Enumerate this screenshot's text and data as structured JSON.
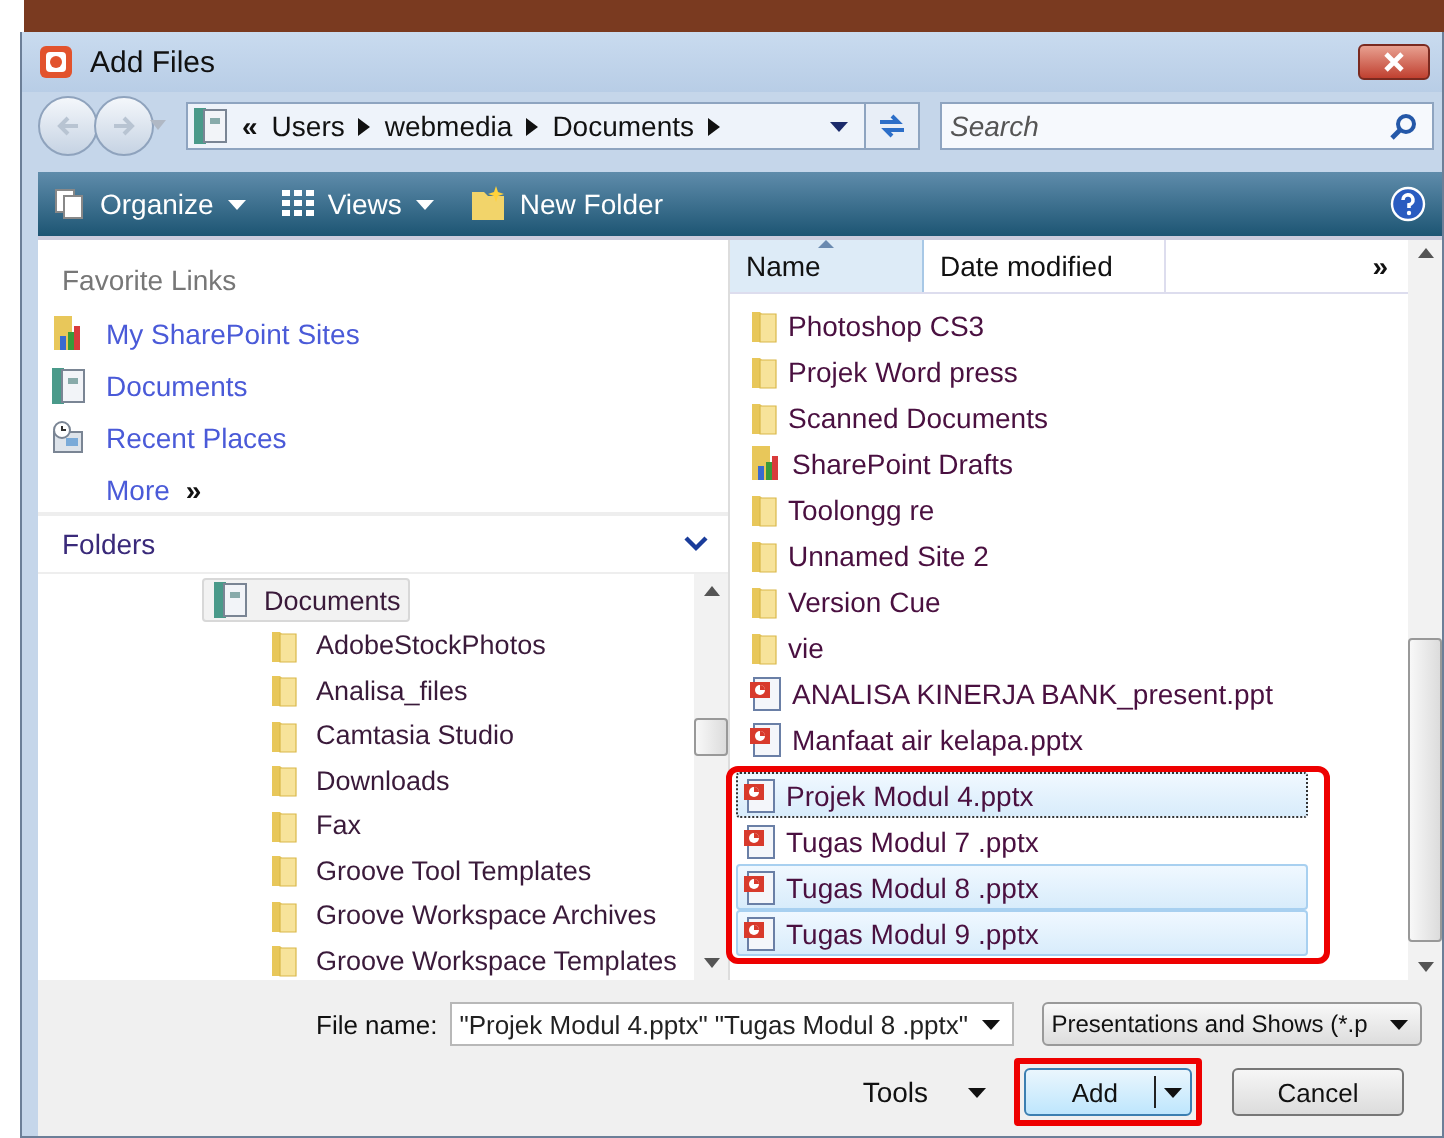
{
  "window": {
    "title": "Add Files"
  },
  "address": {
    "crumbs": [
      "Users",
      "webmedia",
      "Documents"
    ],
    "overflow": "«"
  },
  "search": {
    "placeholder": "Search"
  },
  "toolbar": [
    {
      "kind": "organize",
      "label": "Organize",
      "dropdown": true
    },
    {
      "kind": "views",
      "label": "Views",
      "dropdown": true
    },
    {
      "kind": "newfolder",
      "label": "New Folder",
      "dropdown": false
    }
  ],
  "favorites": {
    "title": "Favorite Links",
    "items": [
      {
        "kind": "sharepoint",
        "label": "My SharePoint Sites"
      },
      {
        "kind": "documents",
        "label": "Documents"
      },
      {
        "kind": "recent",
        "label": "Recent Places"
      }
    ],
    "more": "More",
    "more_icon": "»"
  },
  "folders": {
    "title": "Folders",
    "expanded": true,
    "tree": [
      {
        "label": "Documents",
        "kind": "documents",
        "selected": true,
        "children": [
          {
            "label": "AdobeStockPhotos",
            "kind": "folder",
            "selected": false
          },
          {
            "label": "Analisa_files",
            "kind": "folder",
            "selected": false
          },
          {
            "label": "Camtasia Studio",
            "kind": "folder",
            "selected": false
          },
          {
            "label": "Downloads",
            "kind": "folder",
            "selected": false
          },
          {
            "label": "Fax",
            "kind": "folder",
            "selected": false
          },
          {
            "label": "Groove Tool Templates",
            "kind": "folder",
            "selected": false
          },
          {
            "label": "Groove Workspace Archives",
            "kind": "folder",
            "selected": false
          },
          {
            "label": "Groove Workspace Templates",
            "kind": "folder",
            "selected": false
          }
        ]
      }
    ]
  },
  "columns": [
    "Name",
    "Date modified"
  ],
  "column_overflow": "»",
  "files": [
    {
      "name": "Photoshop CS3",
      "kind": "folder",
      "selected": false,
      "focused": false
    },
    {
      "name": "Projek Word press",
      "kind": "folder",
      "selected": false,
      "focused": false
    },
    {
      "name": "Scanned Documents",
      "kind": "folder",
      "selected": false,
      "focused": false
    },
    {
      "name": "SharePoint Drafts",
      "kind": "sharepoint",
      "selected": false,
      "focused": false
    },
    {
      "name": "Toolongg re",
      "kind": "folder",
      "selected": false,
      "focused": false
    },
    {
      "name": "Unnamed Site 2",
      "kind": "folder",
      "selected": false,
      "focused": false
    },
    {
      "name": "Version Cue",
      "kind": "folder",
      "selected": false,
      "focused": false
    },
    {
      "name": "vie",
      "kind": "folder",
      "selected": false,
      "focused": false
    },
    {
      "name": "ANALISA KINERJA BANK_present.ppt",
      "kind": "ppt",
      "selected": false,
      "focused": false
    },
    {
      "name": "Manfaat air kelapa.pptx",
      "kind": "ppt",
      "selected": false,
      "focused": false
    }
  ],
  "marked_files": [
    {
      "name": "Projek Modul 4.pptx",
      "kind": "ppt",
      "selected": true,
      "focused": true
    },
    {
      "name": "Tugas Modul 7 .pptx",
      "kind": "ppt",
      "selected": false,
      "focused": false
    },
    {
      "name": "Tugas Modul 8 .pptx",
      "kind": "ppt",
      "selected": true,
      "focused": false
    },
    {
      "name": "Tugas Modul 9 .pptx",
      "kind": "ppt",
      "selected": true,
      "focused": false
    }
  ],
  "file_name": {
    "label": "File name:",
    "value": "\"Projek Modul 4.pptx\" \"Tugas Modul 8 .pptx\""
  },
  "file_type": {
    "value": "Presentations and Shows (*.p"
  },
  "tools": {
    "label": "Tools"
  },
  "buttons": [
    {
      "kind": "split",
      "label": "Add",
      "marked": true
    },
    {
      "kind": "plain",
      "label": "Cancel",
      "marked": false
    }
  ]
}
